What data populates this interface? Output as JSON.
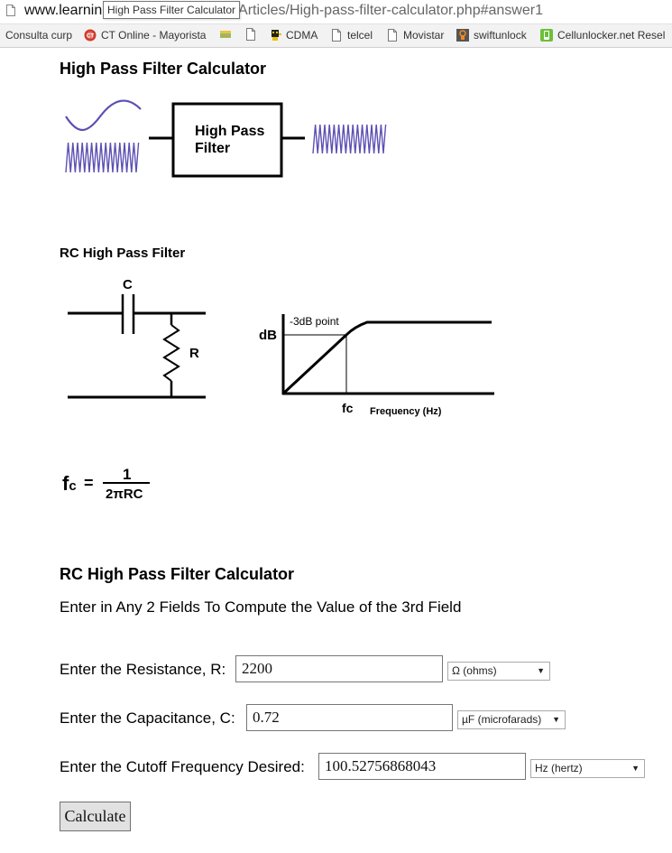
{
  "browser": {
    "url_host": "www.learnin",
    "url_hidden_suffix": "m",
    "url_path": "/Articles/High-pass-filter-calculator.php#answer1",
    "tooltip": "High Pass Filter Calculator",
    "bookmarks": [
      {
        "label": "Consulta curp",
        "icon": "none"
      },
      {
        "label": "CT Online - Mayorista",
        "icon": "ct-logo-icon"
      },
      {
        "label": "",
        "icon": "image-folder-icon"
      },
      {
        "label": "",
        "icon": "page-icon"
      },
      {
        "label": "CDMA",
        "icon": "robot-icon"
      },
      {
        "label": "telcel",
        "icon": "page-icon"
      },
      {
        "label": "Movistar",
        "icon": "page-icon"
      },
      {
        "label": "swiftunlock",
        "icon": "swiftunlock-icon"
      },
      {
        "label": "Cellunlocker.net Resel",
        "icon": "phone-icon"
      }
    ]
  },
  "page": {
    "title": "High Pass Filter Calculator",
    "block_diagram": {
      "box_label_line1": "High Pass",
      "box_label_line2": "Filter",
      "wave_color": "#5b50b2"
    },
    "circuit_section": {
      "title": "RC High Pass Filter",
      "capacitor_label": "C",
      "resistor_label": "R"
    },
    "response_graph": {
      "y_label": "dB",
      "point_label": "-3dB point",
      "x_marker": "fc",
      "x_label": "Frequency (Hz)"
    },
    "formula": {
      "lhs": "fc",
      "equals": "=",
      "numerator": "1",
      "denominator": "2πRC"
    },
    "calculator": {
      "title": "RC High Pass Filter Calculator",
      "instructions": "Enter in Any 2 Fields To Compute the Value of the 3rd Field",
      "resistance": {
        "label": "Enter the Resistance, R:",
        "value": "2200",
        "unit": "Ω (ohms)"
      },
      "capacitance": {
        "label": "Enter the Capacitance, C:",
        "value": "0.72",
        "unit": "µF (microfarads)"
      },
      "frequency": {
        "label": "Enter the Cutoff Frequency Desired:",
        "value": "100.52756868043",
        "unit": "Hz (hertz)"
      },
      "button_label": "Calculate"
    }
  }
}
